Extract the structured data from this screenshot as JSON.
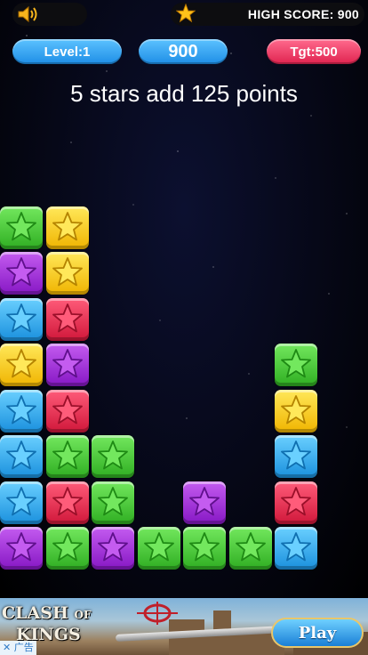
{
  "header": {
    "high_score_label": "HIGH SCORE: 900",
    "sound_icon": "speaker-icon",
    "high_score_icon": "star-icon"
  },
  "stats": {
    "level": "Level:1",
    "score": "900",
    "target": "Tgt:500"
  },
  "message": "5 stars add 125 points",
  "colors": {
    "green": "#4cd13c",
    "yellow": "#ffd31f",
    "purple": "#a523e0",
    "blue": "#2fb2f5",
    "red": "#f0264d",
    "pill_blue": "#2a9cf0",
    "pill_red": "#f0345a"
  },
  "board": {
    "columns": 8,
    "rows": 8,
    "columns_bottom_up": [
      [
        "purple",
        "blue",
        "blue",
        "blue",
        "yellow",
        "blue",
        "purple",
        "green"
      ],
      [
        "green",
        "red",
        "green",
        "red",
        "purple",
        "red",
        "yellow",
        "yellow"
      ],
      [
        "purple",
        "green",
        "green"
      ],
      [
        "green"
      ],
      [
        "green",
        "purple"
      ],
      [
        "green"
      ],
      [
        "blue",
        "red",
        "blue",
        "yellow",
        "green"
      ],
      []
    ]
  },
  "ad": {
    "logo_line1": "CLASH",
    "logo_of": "OF",
    "logo_line2": "KINGS",
    "tag": "✕ 广告",
    "play_label": "Play"
  }
}
